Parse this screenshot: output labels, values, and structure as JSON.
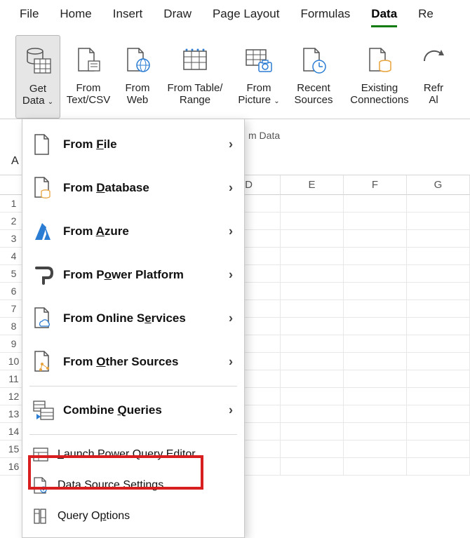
{
  "tabs": {
    "file": "File",
    "home": "Home",
    "insert": "Insert",
    "draw": "Draw",
    "page_layout": "Page Layout",
    "formulas": "Formulas",
    "data": "Data",
    "review_partial": "Re"
  },
  "ribbon": {
    "get_data": "Get\nData",
    "from_text_csv": "From\nText/CSV",
    "from_web": "From\nWeb",
    "from_table_range": "From Table/\nRange",
    "from_picture": "From\nPicture",
    "recent_sources": "Recent\nSources",
    "existing_connections": "Existing\nConnections",
    "refresh_all_partial": "Refr\nAl",
    "group_label_partial": "m Data"
  },
  "name_box": "A",
  "columns": {
    "c3": "D",
    "c4": "E",
    "c5": "F",
    "c6": "G"
  },
  "rows": [
    "1",
    "2",
    "3",
    "4",
    "5",
    "6",
    "7",
    "8",
    "9",
    "10",
    "11",
    "12",
    "13",
    "14",
    "15",
    "16"
  ],
  "menu": {
    "from_file": "From <u>F</u>ile",
    "from_database": "From <u>D</u>atabase",
    "from_azure": "From <u>A</u>zure",
    "from_power_platform": "From P<u>o</u>wer Platform",
    "from_online_services": "From Online S<u>e</u>rvices",
    "from_other_sources": "From <u>O</u>ther Sources",
    "combine_queries": "Combine <u>Q</u>ueries",
    "launch_pqe": "<u>L</u>aunch Power Query Editor...",
    "data_source_settings": "Data Source <u>S</u>ettings...",
    "query_options": "Query O<u>p</u>tions"
  },
  "chevron": "›"
}
